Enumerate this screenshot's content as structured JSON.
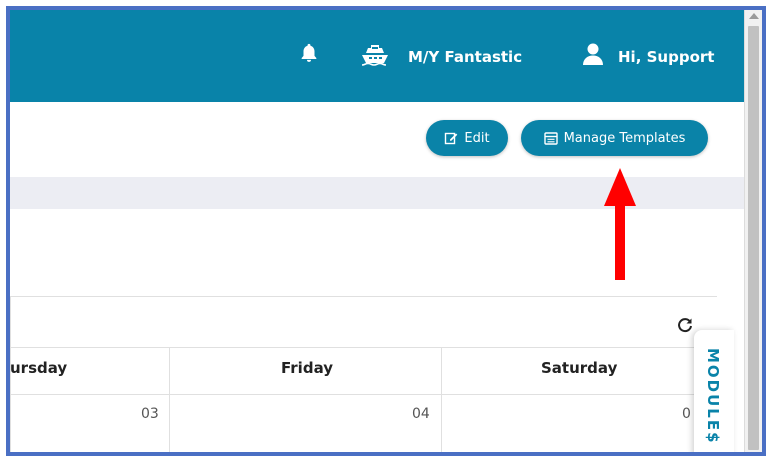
{
  "header": {
    "vessel_name": "M/Y Fantastic",
    "greeting": "Hi, Support",
    "icons": [
      "bell-icon",
      "yacht-icon",
      "user-icon"
    ]
  },
  "toolbar": {
    "edit_label": "Edit",
    "manage_templates_label": "Manage Templates"
  },
  "calendar": {
    "days": [
      {
        "name": "ursday",
        "date": "03"
      },
      {
        "name": "Friday",
        "date": "04"
      },
      {
        "name": "Saturday",
        "date": "0"
      }
    ]
  },
  "side_tab": {
    "label": "MODULE$"
  },
  "colors": {
    "header_bg": "#0983a9",
    "button_bg": "#0a83a8",
    "frame_border": "#4a6fc4",
    "annotation_arrow": "#ff0000"
  }
}
